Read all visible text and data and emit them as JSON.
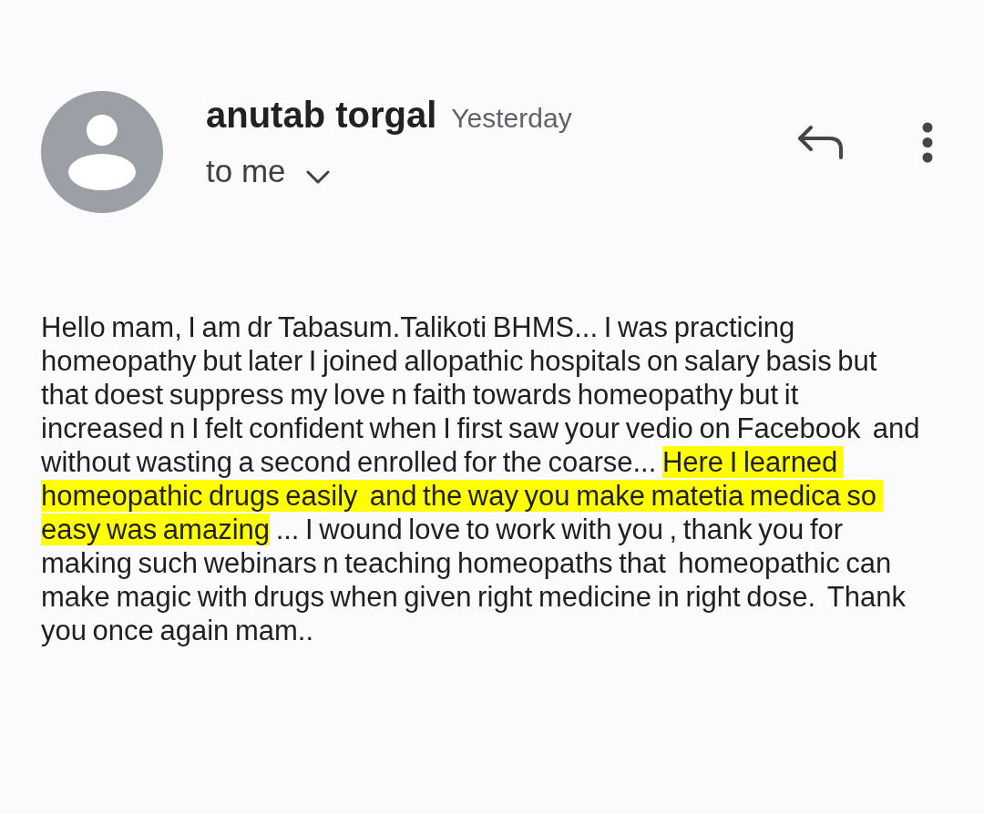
{
  "sender": {
    "name": "anutab torgal",
    "time": "Yesterday",
    "recipient": "to me"
  },
  "body": {
    "segments": [
      {
        "text": "Hello mam, I am dr Tabasum.Talikoti BHMS... I was practicing homeopathy but later I joined allopathic hospitals on salary basis but that doest suppress my love n faith towards homeopathy but it increased n I felt confident when I first saw your vedio on Facebook  and without wasting a second enrolled for the coarse... ",
        "highlighted": false
      },
      {
        "text": "Here I learned homeopathic drugs easily  and the way you make matetia medica so easy was amazing",
        "highlighted": true
      },
      {
        "text": " ... I wound love to work with you , thank you for making such webinars n teaching homeopaths that  homeopathic can make magic with drugs when given right medicine in right dose.  Thank you once again mam..",
        "highlighted": false
      }
    ]
  }
}
